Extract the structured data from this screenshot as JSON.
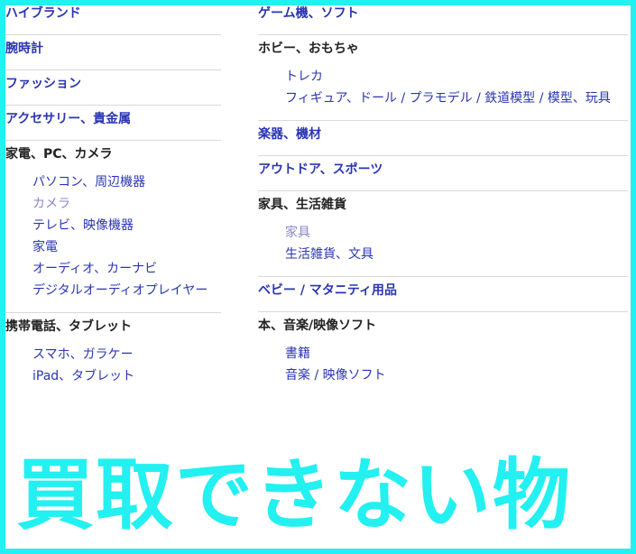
{
  "left_sections": [
    {
      "title": "ハイブランド",
      "link": true,
      "items": []
    },
    {
      "title": "腕時計",
      "link": true,
      "items": []
    },
    {
      "title": "ファッション",
      "link": true,
      "items": []
    },
    {
      "title": "アクセサリー、貴金属",
      "link": true,
      "items": []
    },
    {
      "title": "家電、PC、カメラ",
      "link": false,
      "items": [
        {
          "label": "パソコン、周辺機器",
          "light": false
        },
        {
          "label": "カメラ",
          "light": true
        },
        {
          "label": "テレビ、映像機器",
          "light": false
        },
        {
          "label": "家電",
          "light": false
        },
        {
          "label": "オーディオ、カーナビ",
          "light": false
        },
        {
          "label": "デジタルオーディオプレイヤー",
          "light": false
        }
      ]
    },
    {
      "title": "携帯電話、タブレット",
      "link": false,
      "items": [
        {
          "label": "スマホ、ガラケー",
          "light": false
        },
        {
          "label": "iPad、タブレット",
          "light": false
        }
      ]
    }
  ],
  "right_sections": [
    {
      "title": "ゲーム機、ソフト",
      "link": true,
      "items": []
    },
    {
      "title": "ホビー、おもちゃ",
      "link": false,
      "items": [
        {
          "label": "トレカ",
          "light": false
        },
        {
          "label": "フィギュア、ドール / プラモデル / 鉄道模型 / 模型、玩具",
          "light": false
        }
      ]
    },
    {
      "title": "楽器、機材",
      "link": true,
      "items": []
    },
    {
      "title": "アウトドア、スポーツ",
      "link": true,
      "items": []
    },
    {
      "title": "家具、生活雑貨",
      "link": false,
      "items": [
        {
          "label": "家具",
          "light": true
        },
        {
          "label": "生活雑貨、文具",
          "light": false
        }
      ]
    },
    {
      "title": "ベビー / マタニティ用品",
      "link": true,
      "items": []
    },
    {
      "title": "本、音楽/映像ソフト",
      "link": false,
      "items": [
        {
          "label": "書籍",
          "light": false
        },
        {
          "label": "音楽 / 映像ソフト",
          "light": false
        }
      ]
    }
  ],
  "banner": {
    "text": "買取できない物"
  },
  "colors": {
    "accent": "#23f0f0",
    "link": "#2a35b3",
    "link_light": "#8a86c8"
  }
}
